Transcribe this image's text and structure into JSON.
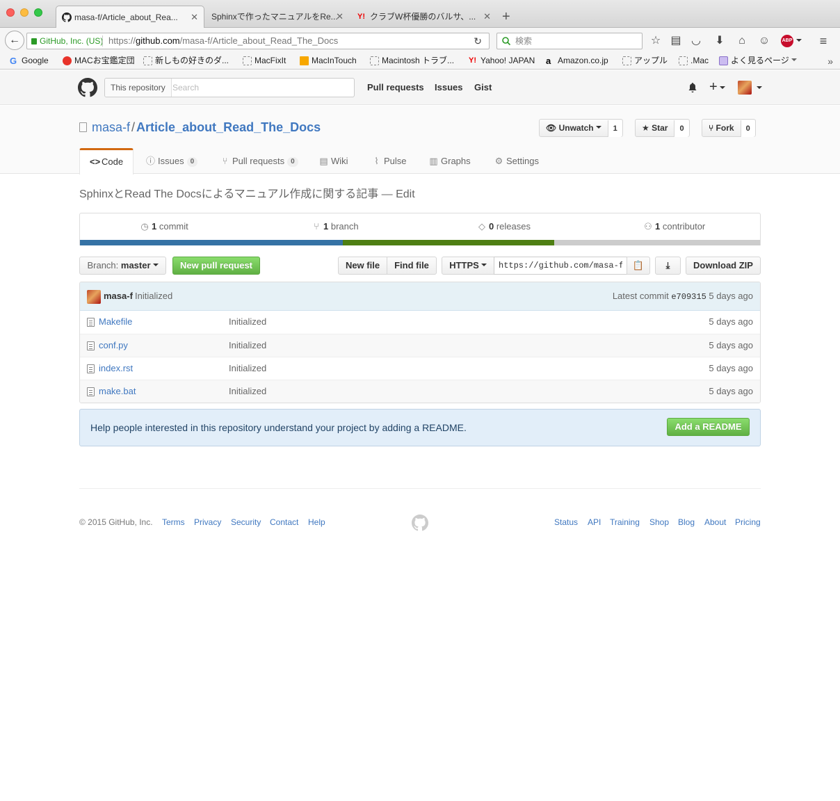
{
  "browser": {
    "tabs": [
      {
        "title": "masa-f/Article_about_Rea..."
      },
      {
        "title": "Sphinxで作ったマニュアルをRe..."
      },
      {
        "title": "クラブW杯優勝のバルサ、..."
      }
    ],
    "new_tab": "+",
    "identity": "GitHub, Inc. (US)",
    "url_prefix": "https://",
    "url_host": "github.com",
    "url_path": "/masa-f/Article_about_Read_The_Docs",
    "search_placeholder": "検索",
    "abp_label": "ABP",
    "bookmarks": [
      {
        "label": "Google"
      },
      {
        "label": "MACお宝鑑定団"
      },
      {
        "label": "新しもの好きのダ..."
      },
      {
        "label": "MacFixIt"
      },
      {
        "label": "MacInTouch"
      },
      {
        "label": "Macintosh トラブ..."
      },
      {
        "label": "Yahoo! JAPAN"
      },
      {
        "label": "Amazon.co.jp"
      },
      {
        "label": "アップル"
      },
      {
        "label": ".Mac"
      },
      {
        "label": "よく見るページ"
      }
    ],
    "bookmarks_more": "»"
  },
  "header": {
    "search_scope": "This repository",
    "search_placeholder": "Search",
    "nav": [
      "Pull requests",
      "Issues",
      "Gist"
    ]
  },
  "repo": {
    "owner": "masa-f",
    "separator": "/",
    "name": "Article_about_Read_The_Docs",
    "unwatch_label": "Unwatch",
    "watch_count": "1",
    "star_label": "Star",
    "star_count": "0",
    "fork_label": "Fork",
    "fork_count": "0",
    "tabs": [
      {
        "label": "Code",
        "icon": "<>",
        "counter": ""
      },
      {
        "label": "Issues",
        "icon": "ⓘ",
        "counter": "0"
      },
      {
        "label": "Pull requests",
        "icon": "⑂",
        "counter": "0"
      },
      {
        "label": "Wiki",
        "icon": "▤",
        "counter": ""
      },
      {
        "label": "Pulse",
        "icon": "⌇",
        "counter": ""
      },
      {
        "label": "Graphs",
        "icon": "▥",
        "counter": ""
      },
      {
        "label": "Settings",
        "icon": "⚙",
        "counter": ""
      }
    ],
    "description": "SphinxとRead The Docsによるマニュアル作成に関する記事",
    "description_edit": " — Edit"
  },
  "summary": {
    "commits_count": "1",
    "commits_label": " commit",
    "branches_count": "1",
    "branches_label": " branch",
    "releases_count": "0",
    "releases_label": " releases",
    "contributors_count": "1",
    "contributors_label": " contributor",
    "language_colors": [
      "#3572a5",
      "#4e7f13",
      "#cccccc"
    ],
    "language_shares": [
      0.387,
      0.31,
      0.303
    ]
  },
  "toolbar": {
    "branch_prefix": "Branch: ",
    "branch_name": "master",
    "new_pull_request": "New pull request",
    "new_file": "New file",
    "find_file": "Find file",
    "protocol": "HTTPS",
    "clone_url": "https://github.com/masa-f/Article_about_Read_The_Docs.git",
    "download_zip": "Download ZIP"
  },
  "latest_commit": {
    "author": "masa-f",
    "message": "Initialized",
    "label": "Latest commit ",
    "sha": "e709315",
    "age": " 5 days ago"
  },
  "files": [
    {
      "name": "Makefile",
      "message": "Initialized",
      "age": "5 days ago"
    },
    {
      "name": "conf.py",
      "message": "Initialized",
      "age": "5 days ago"
    },
    {
      "name": "index.rst",
      "message": "Initialized",
      "age": "5 days ago"
    },
    {
      "name": "make.bat",
      "message": "Initialized",
      "age": "5 days ago"
    }
  ],
  "readme_prompt": {
    "text": "Help people interested in this repository understand your project by adding a README.",
    "button": "Add a README"
  },
  "footer": {
    "copyright": "© 2015 GitHub, Inc.",
    "left_links": [
      "Terms",
      "Privacy",
      "Security",
      "Contact",
      "Help"
    ],
    "right_links": [
      "Status",
      "API",
      "Training",
      "Shop",
      "Blog",
      "About",
      "Pricing"
    ]
  },
  "colors": {
    "link": "#4078c0",
    "primary_green": "#60b044",
    "selected_tab_accent": "#d26911",
    "commit_tease_bg": "#e6f1f6",
    "readme_bg": "#e2eef9"
  }
}
